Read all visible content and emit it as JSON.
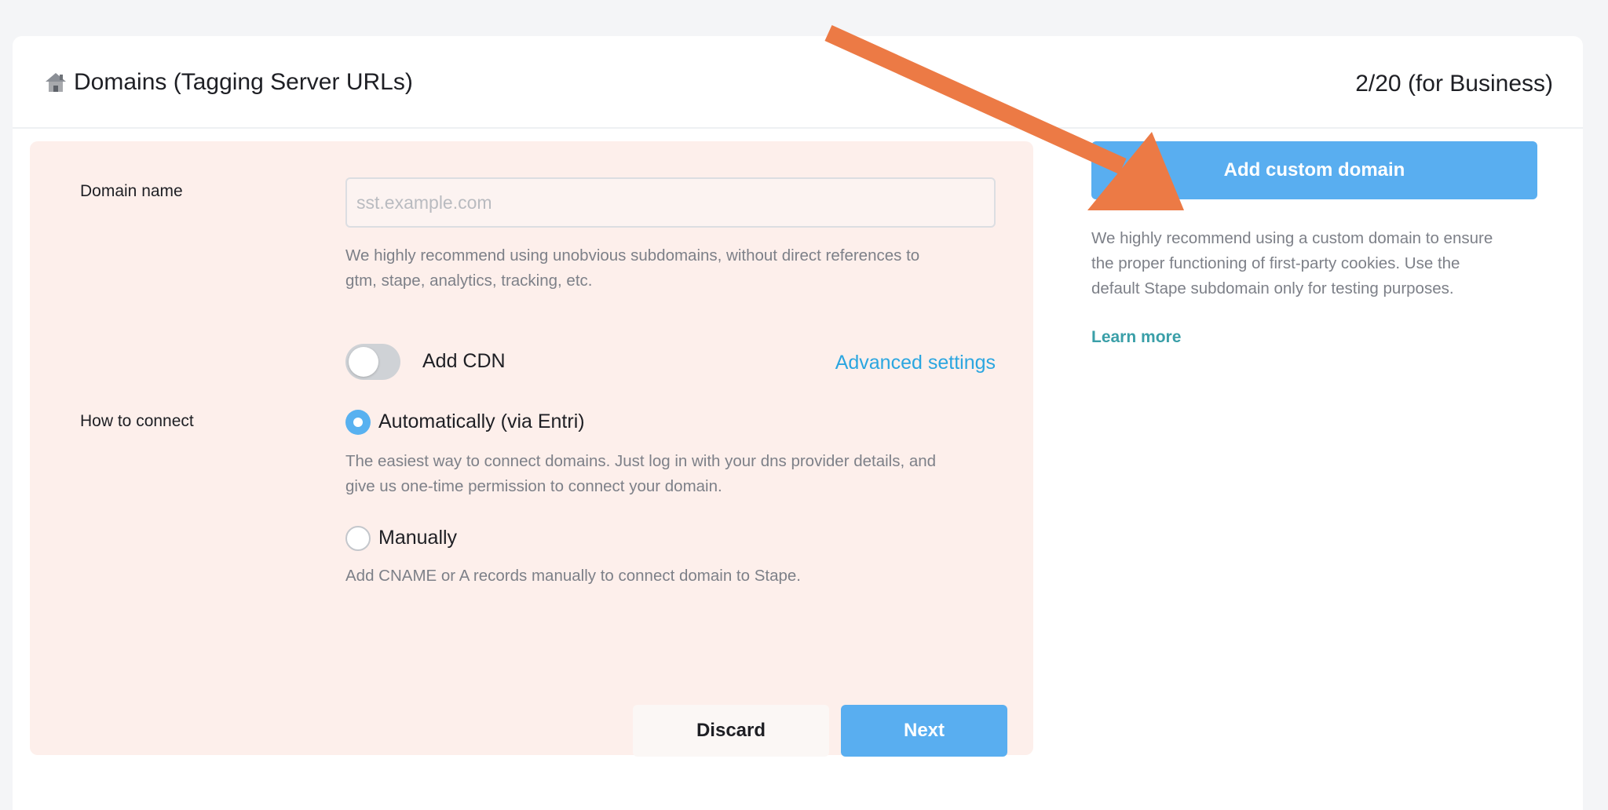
{
  "header": {
    "title": "Domains (Tagging Server URLs)",
    "usage": "2/20 (for Business)",
    "title_icon": "tagging-server-icon"
  },
  "form": {
    "domain_label": "Domain name",
    "domain_placeholder": "sst.example.com",
    "domain_value": "",
    "domain_help_line1": "We highly recommend using unobvious subdomains, without direct references to",
    "domain_help_line2": "gtm, stape, analytics, tracking, etc.",
    "cdn_label": "Add CDN",
    "cdn_enabled": false,
    "advanced_label": "Advanced settings",
    "connect_label": "How to connect",
    "auto_label": "Automatically (via Entri)",
    "auto_selected": true,
    "auto_help_line1": "The easiest way to connect domains. Just log in with your dns provider details, and",
    "auto_help_line2": "give us one-time permission to connect your domain.",
    "manual_label": "Manually",
    "manual_help": "Add CNAME or A records manually to connect domain to Stape.",
    "discard_label": "Discard",
    "next_label": "Next"
  },
  "sidebar": {
    "add_button_label": "Add custom domain",
    "help_line1": "We highly recommend using a custom domain to ensure",
    "help_line2": "the proper functioning of first-party cookies. Use the",
    "help_line3": "default Stape subdomain only for testing purposes.",
    "learn_more_label": "Learn more"
  },
  "colors": {
    "accent": "#59aef0",
    "link": "#2ba6e0",
    "panel_bg": "#fdefeb",
    "learn_more": "#3a9fa8",
    "annotation_arrow": "#ec7a45"
  }
}
